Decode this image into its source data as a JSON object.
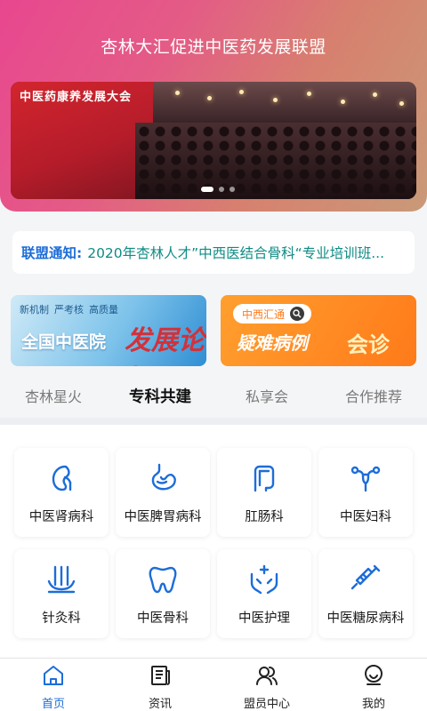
{
  "header": {
    "title": "杏林大汇促进中医药发展联盟"
  },
  "banner": {
    "stage_title": "中医药康养发展大会"
  },
  "notice": {
    "label": "联盟通知:",
    "text": "2020年杏林人才”中西医结合骨科“专业培训班..."
  },
  "promos": {
    "left": {
      "tags": [
        "新机制",
        "严考核",
        "高质量"
      ],
      "main": "全国中医院",
      "accent": "发展论坛"
    },
    "right": {
      "badge": "中西汇通",
      "main": "疑难病例",
      "accent": "会诊"
    }
  },
  "tabs": [
    {
      "label": "杏林星火"
    },
    {
      "label": "专科共建"
    },
    {
      "label": "私享会"
    },
    {
      "label": "合作推荐"
    }
  ],
  "departments": [
    {
      "label": "中医肾病科",
      "icon": "kidney-icon"
    },
    {
      "label": "中医脾胃病科",
      "icon": "stomach-icon"
    },
    {
      "label": "肛肠科",
      "icon": "intestine-icon"
    },
    {
      "label": "中医妇科",
      "icon": "uterus-icon"
    },
    {
      "label": "针灸科",
      "icon": "acupuncture-icon"
    },
    {
      "label": "中医骨科",
      "icon": "tooth-bone-icon"
    },
    {
      "label": "中医护理",
      "icon": "care-hands-icon"
    },
    {
      "label": "中医糖尿病科",
      "icon": "syringe-icon"
    }
  ],
  "nav": [
    {
      "label": "首页",
      "icon": "home-icon"
    },
    {
      "label": "资讯",
      "icon": "news-icon"
    },
    {
      "label": "盟员中心",
      "icon": "members-icon"
    },
    {
      "label": "我的",
      "icon": "profile-icon"
    }
  ],
  "colors": {
    "accent": "#1d6dd8",
    "notice_text": "#0e8b84",
    "header_start": "#e8478f",
    "header_end": "#c99a78"
  }
}
